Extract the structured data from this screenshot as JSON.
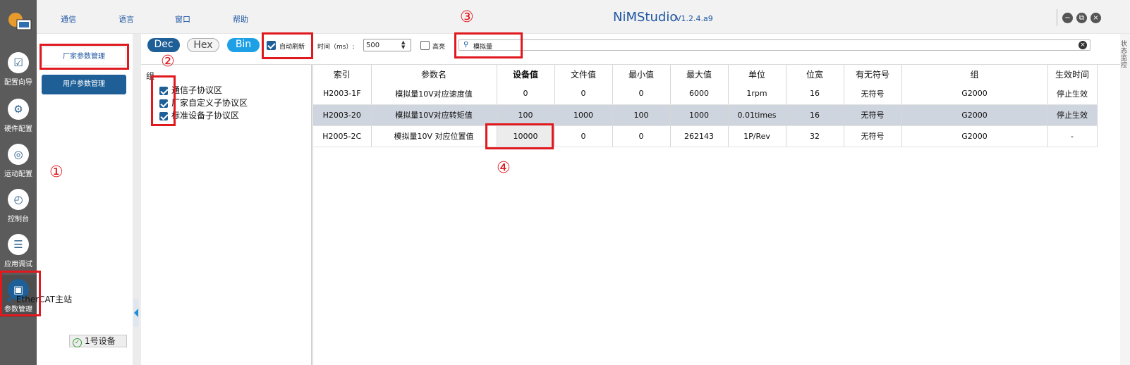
{
  "app": {
    "title": "NiMStudio",
    "version": "V1.2.4.a9"
  },
  "menu": [
    "通信",
    "语言",
    "窗口",
    "帮助"
  ],
  "window_controls": [
    "−",
    "⧉",
    "×"
  ],
  "rail": [
    {
      "label": "配置向导",
      "icon": "wizard-icon",
      "glyph": "☑"
    },
    {
      "label": "硬件配置",
      "icon": "hardware-config-icon",
      "glyph": "⚙"
    },
    {
      "label": "运动配置",
      "icon": "motion-config-icon",
      "glyph": "◎"
    },
    {
      "label": "控制台",
      "icon": "console-icon",
      "glyph": "◴"
    },
    {
      "label": "应用调试",
      "icon": "app-debug-icon",
      "glyph": "☰"
    },
    {
      "label": "参数管理",
      "icon": "param-manage-icon",
      "glyph": "▣"
    }
  ],
  "side_strip": "状态监控",
  "panel2": {
    "vendor_btn": "厂家参数管理",
    "user_btn": "用户参数管理",
    "tree_root": "EtherCAT主站",
    "tree_child": "1号设备"
  },
  "toolbar": {
    "dec": "Dec",
    "hex": "Hex",
    "bin": "Bin",
    "auto_refresh": "自动刷新",
    "time_label": "时间（ms）:",
    "time_value": "500",
    "highlight": "高亮",
    "search_text": "模拟量"
  },
  "group": {
    "title": "组",
    "items": [
      "通信子协议区",
      "厂家自定义子协议区",
      "标准设备子协议区"
    ]
  },
  "table": {
    "headers": [
      "索引",
      "参数名",
      "设备值",
      "文件值",
      "最小值",
      "最大值",
      "单位",
      "位宽",
      "有无符号",
      "组",
      "生效时间"
    ],
    "rows": [
      [
        "H2003-1F",
        "模拟量10V对应速度值",
        "0",
        "0",
        "0",
        "6000",
        "1rpm",
        "16",
        "无符号",
        "G2000",
        "停止生效"
      ],
      [
        "H2003-20",
        "模拟量10V对应转矩值",
        "100",
        "1000",
        "100",
        "1000",
        "0.01times",
        "16",
        "无符号",
        "G2000",
        "停止生效"
      ],
      [
        "H2005-2C",
        "模拟量10V 对应位置值",
        "10000",
        "0",
        "0",
        "262143",
        "1P/Rev",
        "32",
        "无符号",
        "G2000",
        "-"
      ]
    ]
  },
  "annotations": [
    "①",
    "②",
    "③",
    "④"
  ],
  "colors": {
    "accent": "#1e5f97",
    "annotation": "#e0191f",
    "title": "#1f56a3"
  }
}
